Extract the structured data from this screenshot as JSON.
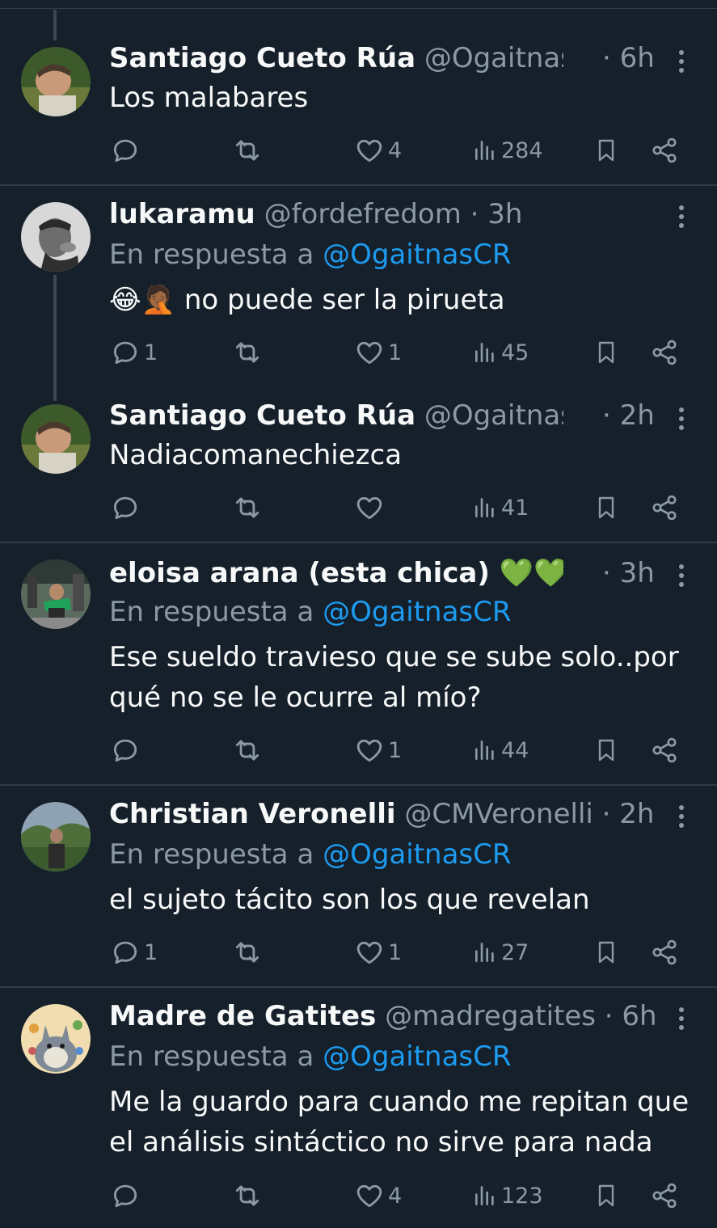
{
  "tweets": [
    {
      "name": "Santiago Cueto Rúa",
      "handle": "@Ogaitnas...",
      "time": "· 6h",
      "reply_label": "",
      "reply_mention": "",
      "text": "Los malabares",
      "replies": "",
      "likes": "4",
      "views": "284",
      "avatar": "man-lying-on-grass-photo"
    },
    {
      "name": "lukaramu",
      "handle": "@fordefredom",
      "time": "· 3h",
      "reply_label": "En respuesta a ",
      "reply_mention": "@OgaitnasCR",
      "text": "😂🤦🏾 no puede ser la pirueta",
      "replies": "1",
      "likes": "1",
      "views": "45",
      "avatar": "black-and-white-man-portrait"
    },
    {
      "name": "Santiago Cueto Rúa",
      "handle": "@Ogaitnas...",
      "time": "· 2h",
      "reply_label": "",
      "reply_mention": "",
      "text": "Nadiacomanechiezca",
      "replies": "",
      "likes": "",
      "views": "41",
      "avatar": "man-lying-on-grass-photo"
    },
    {
      "name": "eloisa arana (esta chica) 💚💚 ...",
      "handle": "",
      "time": "· 3h",
      "reply_label": "En respuesta a ",
      "reply_mention": "@OgaitnasCR",
      "text": "Ese sueldo travieso que se sube solo..por qué no se le ocurre al mío?",
      "replies": "",
      "likes": "1",
      "views": "44",
      "avatar": "protest-crowd-green-scarf-photo"
    },
    {
      "name": "Christian Veronelli",
      "handle": "@CMVeronelli",
      "time": "· 2h",
      "reply_label": "En respuesta a ",
      "reply_mention": "@OgaitnasCR",
      "text": "el sujeto tácito son los que revelan",
      "replies": "1",
      "likes": "1",
      "views": "27",
      "avatar": "man-outdoors-trees-photo"
    },
    {
      "name": "Madre de Gatites",
      "handle": "@madregatites",
      "time": "· 6h",
      "reply_label": "En respuesta a ",
      "reply_mention": "@OgaitnasCR",
      "text": "Me la guardo para cuando me repitan que el análisis sintáctico no sirve para nada",
      "replies": "",
      "likes": "4",
      "views": "123",
      "avatar": "totoro-illustration"
    }
  ],
  "icons": {
    "reply": "reply-icon",
    "retweet": "retweet-icon",
    "like": "heart-icon",
    "views": "views-icon",
    "bookmark": "bookmark-icon",
    "share": "share-icon",
    "more": "more-vertical-icon"
  },
  "colors": {
    "background": "#15202b",
    "text": "#f7f9f9",
    "muted": "#8b98a5",
    "link": "#1d9bf0",
    "divider": "#2f3b47"
  }
}
